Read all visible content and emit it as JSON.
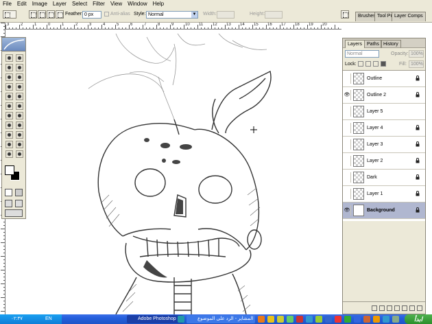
{
  "menu": [
    "File",
    "Edit",
    "Image",
    "Layer",
    "Select",
    "Filter",
    "View",
    "Window",
    "Help"
  ],
  "options": {
    "feather_label": "Feather:",
    "feather_value": "0 px",
    "antialias_label": "Anti-alias",
    "style_label": "Style:",
    "style_value": "Normal",
    "width_label": "Width:",
    "height_label": "Height:",
    "panel_tabs": [
      "Brushes",
      "Tool Pr",
      "Layer Comps"
    ]
  },
  "ruler_top_labels": [
    "3",
    "2",
    "1",
    "0",
    "1",
    "2",
    "3",
    "4",
    "5",
    "6",
    "7",
    "8",
    "9",
    "10",
    "11",
    "12",
    "13",
    "14",
    "15",
    "16",
    "17",
    "18",
    "19",
    "20"
  ],
  "layers_panel": {
    "tabs": [
      "Layers",
      "Paths",
      "History"
    ],
    "blend_mode": "Normal",
    "opacity_label": "Opacity:",
    "opacity_value": "100%",
    "lock_label": "Lock:",
    "fill_label": "Fill:",
    "fill_value": "100%",
    "layers": [
      {
        "name": "Outline",
        "visible": false,
        "locked": true,
        "selected": false
      },
      {
        "name": "Outline 2",
        "visible": true,
        "locked": true,
        "selected": false
      },
      {
        "name": "Layer 5",
        "visible": false,
        "locked": false,
        "selected": false
      },
      {
        "name": "Layer 4",
        "visible": false,
        "locked": true,
        "selected": false
      },
      {
        "name": "Layer 3",
        "visible": false,
        "locked": true,
        "selected": false
      },
      {
        "name": "Layer 2",
        "visible": false,
        "locked": true,
        "selected": false
      },
      {
        "name": "Dark",
        "visible": false,
        "locked": true,
        "selected": false
      },
      {
        "name": "Layer 1",
        "visible": false,
        "locked": true,
        "selected": false
      },
      {
        "name": "Background",
        "visible": true,
        "locked": true,
        "selected": true
      }
    ]
  },
  "taskbar": {
    "clock": "٠٢:٣٧",
    "language": "EN",
    "tasks": [
      "Adobe Photoshop",
      "المشاير - الرد على الموضوع"
    ],
    "start_label": "ابدأ"
  },
  "colors": {
    "chrome": "#ece9d8",
    "taskbar_blue": "#245edb",
    "layer_selected": "#b0b7d0"
  }
}
